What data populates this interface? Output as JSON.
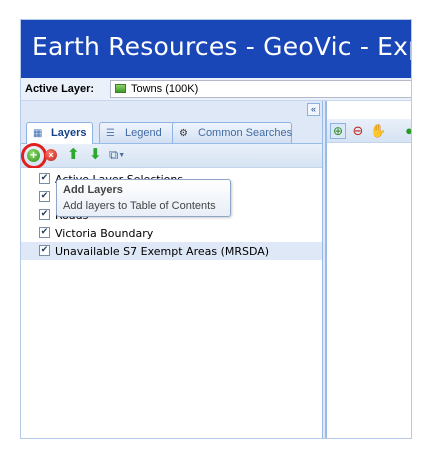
{
  "header": {
    "title": "Earth Resources - GeoVic - Explore"
  },
  "active_layer": {
    "label": "Active Layer:",
    "value": "Towns (100K)"
  },
  "tabs": [
    {
      "label": "Layers",
      "icon": "layers-icon",
      "active": true
    },
    {
      "label": "Legend",
      "icon": "legend-icon",
      "active": false
    },
    {
      "label": "Common Searches",
      "icon": "binoculars-icon",
      "active": false
    }
  ],
  "collapse_glyph": "«",
  "toolbar": {
    "add_icon": "+",
    "remove_icon": "×",
    "up_icon": "⬆",
    "down_icon": "⬇",
    "options_icon": "⧉",
    "options_caret": "▼"
  },
  "tooltip": {
    "title": "Add Layers",
    "body": "Add layers to Table of Contents"
  },
  "layers": [
    {
      "label": "Active Layer Selections",
      "checked": true
    },
    {
      "label": "",
      "checked": true
    },
    {
      "label": "Roads",
      "checked": true
    },
    {
      "label": "Victoria Boundary",
      "checked": true
    },
    {
      "label": "Unavailable S7 Exempt Areas (MRSDA)",
      "checked": true
    }
  ],
  "check_glyph": "✔",
  "map_toolbar": {
    "zoom_in_icon": "⊕",
    "zoom_out_icon": "⊖",
    "pan_icon": "✋",
    "next_icon": "●"
  },
  "colors": {
    "title_bar": "#1a47b7",
    "highlight_ring": "#e0201c",
    "selected_row": "#dfe8f6"
  }
}
